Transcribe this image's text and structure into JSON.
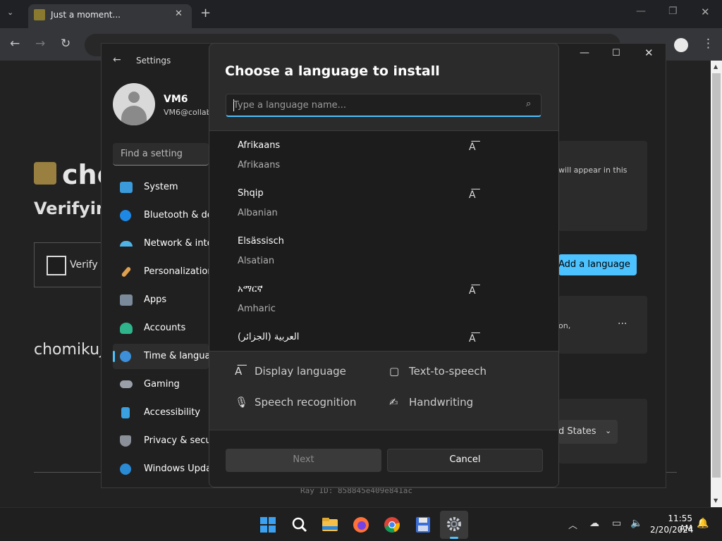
{
  "browser": {
    "tab_title": "Just a moment...",
    "tab_close": "✕",
    "new_tab": "+",
    "tab_search_glyph": "⌄",
    "window_min": "—",
    "window_max": "❐",
    "window_close": "✕",
    "back_glyph": "←",
    "forward_glyph": "→",
    "reload_glyph": "↻",
    "menu_glyph": "⋮"
  },
  "page": {
    "heading": "cho",
    "subheading": "Verifying",
    "verify_label": "Verify y",
    "site_text": "chomikuj",
    "ray_id": "Ray ID: 858845e409e841ac"
  },
  "settings": {
    "back_glyph": "←",
    "title": "Settings",
    "min_glyph": "—",
    "max_glyph": "☐",
    "close_glyph": "✕",
    "user_name": "VM6",
    "user_email": "VM6@collab",
    "find_placeholder": "Find a setting",
    "nav": [
      {
        "label": "System",
        "color": "#3b9ad9"
      },
      {
        "label": "Bluetooth & devices",
        "color": "#1e88e5"
      },
      {
        "label": "Network & internet",
        "color": "#4fb3e8"
      },
      {
        "label": "Personalization",
        "color": "#e0a050"
      },
      {
        "label": "Apps",
        "color": "#7a8a9a"
      },
      {
        "label": "Accounts",
        "color": "#2fb38a"
      },
      {
        "label": "Time & language",
        "color": "#3c8fd8"
      },
      {
        "label": "Gaming",
        "color": "#9aa0a8"
      },
      {
        "label": "Accessibility",
        "color": "#3aa0e0"
      },
      {
        "label": "Privacy & security",
        "color": "#8a8f98"
      },
      {
        "label": "Windows Update",
        "color": "#2a8ad4"
      }
    ],
    "content_hint": "will appear in this",
    "add_language": "Add a language",
    "content_hint2": "on,",
    "more_glyph": "···",
    "region_value": "d States",
    "region_chevron": "⌄",
    "accent": "#4cc2ff"
  },
  "dialog": {
    "title": "Choose a language to install",
    "search_placeholder": "Type a language name...",
    "search_glyph": "⌕",
    "languages": [
      {
        "native": "Afrikaans",
        "english": "Afrikaans",
        "badge": "A͞"
      },
      {
        "native": "Shqip",
        "english": "Albanian",
        "badge": "A͞"
      },
      {
        "native": "Elsässisch",
        "english": "Alsatian",
        "badge": ""
      },
      {
        "native": "አማርኛ",
        "english": "Amharic",
        "badge": "A͞"
      },
      {
        "native": "العربية (الجزائر)",
        "english": "",
        "badge": "A͞"
      }
    ],
    "features": [
      {
        "icon": "A͞",
        "label": "Display language"
      },
      {
        "icon": "▢",
        "label": "Text-to-speech"
      },
      {
        "icon": "🎙",
        "label": "Speech recognition"
      },
      {
        "icon": "✍",
        "label": "Handwriting"
      }
    ],
    "next": "Next",
    "cancel": "Cancel"
  },
  "taskbar": {
    "tray_chevron": "︿",
    "tray_cloud": "☁",
    "tray_monitor": "▭",
    "tray_volume": "🔈",
    "time": "11:55 AM",
    "date": "2/20/2024",
    "bell": "🔔"
  }
}
